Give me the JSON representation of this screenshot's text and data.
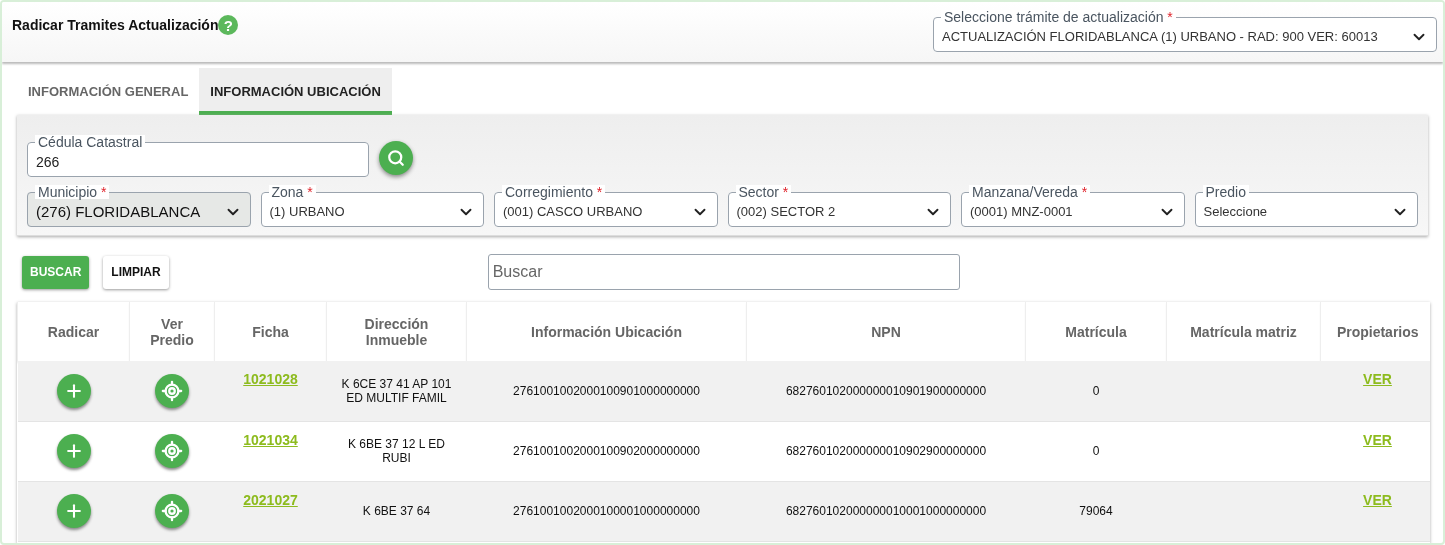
{
  "header": {
    "title": "Radicar Tramites Actualización",
    "help": "?",
    "tramite_select": {
      "label": "Seleccione trámite de actualización",
      "required_mark": "*",
      "value": "ACTUALIZACIÓN FLORIDABLANCA (1) URBANO - RAD: 900 VER: 60013"
    }
  },
  "tabs": [
    {
      "label": "INFORMACIÓN GENERAL",
      "selected": false
    },
    {
      "label": "INFORMACIÓN UBICACIÓN",
      "selected": true
    }
  ],
  "filters": {
    "cedula": {
      "label": "Cédula Catastral",
      "value": "266"
    },
    "selects": [
      {
        "label": "Municipio",
        "required_mark": "*",
        "value": "(276) FLORIDABLANCA",
        "disabled": true
      },
      {
        "label": "Zona",
        "required_mark": "*",
        "value": "(1) URBANO",
        "disabled": false
      },
      {
        "label": "Corregimiento",
        "required_mark": "*",
        "value": "(001) CASCO URBANO",
        "disabled": false
      },
      {
        "label": "Sector",
        "required_mark": "*",
        "value": "(002) SECTOR 2",
        "disabled": false
      },
      {
        "label": "Manzana/Vereda",
        "required_mark": "*",
        "value": "(0001) MNZ-0001",
        "disabled": false
      },
      {
        "label": "Predio",
        "value": "Seleccione",
        "disabled": false
      }
    ]
  },
  "actions": {
    "buscar": "BUSCAR",
    "limpiar": "LIMPIAR",
    "search": {
      "placeholder": "Buscar"
    }
  },
  "table": {
    "columns": [
      "Radicar",
      "Ver Predio",
      "Ficha",
      "Dirección Inmueble",
      "Información Ubicación",
      "NPN",
      "Matrícula",
      "Matrícula matriz",
      "Propietarios"
    ],
    "rows": [
      {
        "ficha": "1021028",
        "direccion": "K 6CE 37 41 AP 101 ED MULTIF FAMIL",
        "ubicacion": "2761001002000100901000000000",
        "npn": "682760102000000010901900000000",
        "matricula": "0",
        "propietarios": "VER"
      },
      {
        "ficha": "1021034",
        "direccion": "K 6BE 37 12 L ED RUBI",
        "ubicacion": "2761001002000100902000000000",
        "npn": "682760102000000010902900000000",
        "matricula": "0",
        "propietarios": "VER"
      },
      {
        "ficha": "2021027",
        "direccion": "K 6BE 37 64",
        "ubicacion": "2761001002000100001000000000",
        "npn": "682760102000000010001000000000",
        "matricula": "79064",
        "propietarios": "VER"
      }
    ]
  }
}
